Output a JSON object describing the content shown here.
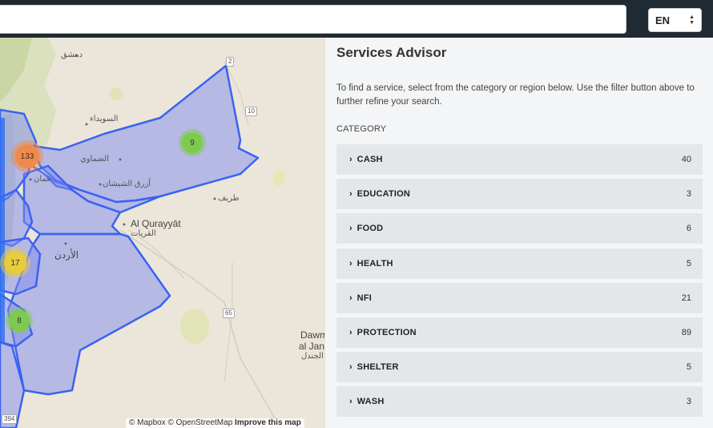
{
  "header": {
    "search_value": "",
    "language": "EN"
  },
  "map": {
    "labels": {
      "damascus": "دمشق",
      "suwayda": "السويداء",
      "dhiyaa": "الضماوي",
      "amman": "عمان",
      "azraq": "أزرق الشيشان",
      "tarif": "طريف",
      "qurayyat_en": "Al Qurayyāt",
      "qurayyat_ar": "القريات",
      "jordan": "الأردن",
      "dawm_en_1": "Dawm",
      "dawm_en_2": "al Jan",
      "dawm_ar": "الجندل",
      "road_2": "2",
      "road_10": "10",
      "road_65": "65",
      "road_394": "394"
    },
    "clusters": [
      {
        "count": "133",
        "color": "#f08a4b"
      },
      {
        "count": "9",
        "color": "#7dcb4e"
      },
      {
        "count": "17",
        "color": "#e8cc3c"
      },
      {
        "count": "8",
        "color": "#7dcb4e"
      }
    ],
    "attribution": {
      "mapbox": "© Mapbox",
      "osm": "© OpenStreetMap",
      "improve": "Improve this map"
    }
  },
  "panel": {
    "title": "Services Advisor",
    "intro": "To find a service, select from the category or region below. Use the filter button above to further refine your search.",
    "section_label": "CATEGORY",
    "categories": [
      {
        "name": "CASH",
        "count": "40"
      },
      {
        "name": "EDUCATION",
        "count": "3"
      },
      {
        "name": "FOOD",
        "count": "6"
      },
      {
        "name": "HEALTH",
        "count": "5"
      },
      {
        "name": "NFI",
        "count": "21"
      },
      {
        "name": "PROTECTION",
        "count": "89"
      },
      {
        "name": "SHELTER",
        "count": "5"
      },
      {
        "name": "WASH",
        "count": "3"
      }
    ]
  },
  "colors": {
    "topbar": "#1f2a33",
    "region_fill": "#7f8cf0",
    "region_stroke": "#3b63f0",
    "panel_bg": "#f4f5f6",
    "row_bg": "#e4e7ea"
  }
}
